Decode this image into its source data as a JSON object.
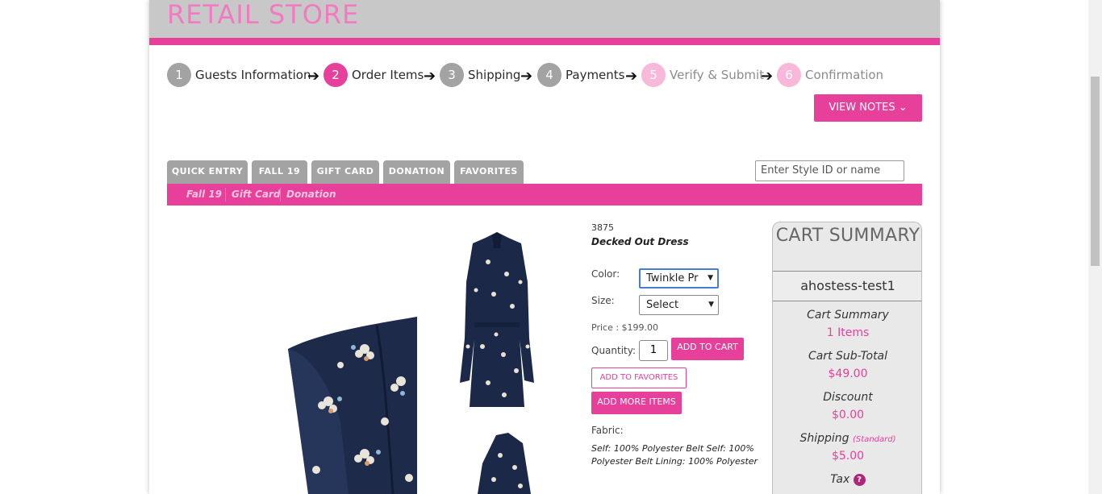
{
  "header": {
    "brand": "RETAIL STORE"
  },
  "steps": [
    {
      "num": "1",
      "label": "Guests Information",
      "state": "done"
    },
    {
      "num": "2",
      "label": "Order Items",
      "state": "active"
    },
    {
      "num": "3",
      "label": "Shipping",
      "state": "done"
    },
    {
      "num": "4",
      "label": "Payments",
      "state": "done"
    },
    {
      "num": "5",
      "label": "Verify & Submit",
      "state": "future"
    },
    {
      "num": "6",
      "label": "Confirmation",
      "state": "future"
    }
  ],
  "view_notes": {
    "label": "VIEW NOTES",
    "icon": "chevron-down-icon"
  },
  "tabs": [
    "QUICK ENTRY",
    "FALL 19",
    "GIFT CARD",
    "DONATION",
    "FAVORITES"
  ],
  "search": {
    "placeholder": "Enter Style ID or name"
  },
  "subnav": [
    "Fall 19",
    "Gift Card",
    "Donation"
  ],
  "product": {
    "style_id": "3875",
    "name": "Decked Out Dress",
    "color_label": "Color:",
    "color_value": "Twinkle Pr",
    "size_label": "Size:",
    "size_value": "Select",
    "price": "Price : $199.00",
    "quantity_label": "Quantity:",
    "quantity_value": "1",
    "add_to_cart": "ADD TO CART",
    "add_to_favorites": "ADD TO FAVORITES",
    "add_more_items": "ADD MORE ITEMS",
    "fabric_label": "Fabric:",
    "fabric_text": "Self: 100% Polyester Belt Self: 100% Polyester Belt Lining: 100% Polyester"
  },
  "cart": {
    "title": "CART SUMMARY",
    "user": "ahostess-test1",
    "summary_label": "Cart Summary",
    "items": "1 Items",
    "subtotal_label": "Cart Sub-Total",
    "subtotal": "$49.00",
    "discount_label": "Discount",
    "discount": "$0.00",
    "shipping_label": "Shipping",
    "shipping_note": "(Standard)",
    "shipping": "$5.00",
    "tax_label": "Tax",
    "tax_help": "?"
  },
  "colors": {
    "accent": "#e6409a",
    "gray": "#a3a3a3"
  }
}
